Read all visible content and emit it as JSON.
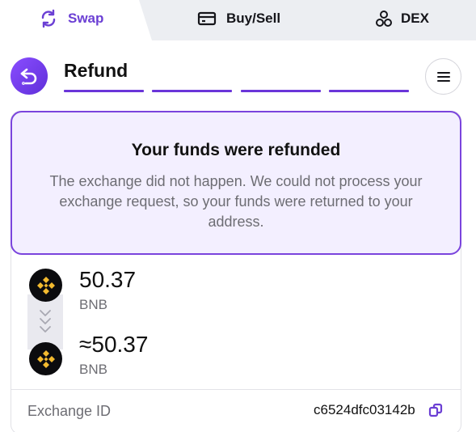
{
  "tabs": [
    {
      "label": "Swap",
      "icon": "swap-icon",
      "active": true
    },
    {
      "label": "Buy/Sell",
      "icon": "card-icon",
      "active": false
    },
    {
      "label": "DEX",
      "icon": "dex-icon",
      "active": false
    }
  ],
  "header": {
    "title": "Refund",
    "steps_total": 4,
    "back_icon": "back-arrow-icon",
    "menu_icon": "hamburger-icon"
  },
  "notice": {
    "title": "Your funds were refunded",
    "text": "The exchange did not happen. We could not process your exchange request, so your funds were returned to your address."
  },
  "exchange": {
    "from": {
      "amount": "50.37",
      "ticker": "BNB",
      "icon": "bnb-icon"
    },
    "to": {
      "amount": "≈50.37",
      "ticker": "BNB",
      "icon": "bnb-icon"
    }
  },
  "details": {
    "exchange_id_label": "Exchange ID",
    "exchange_id_value": "c6524dfc03142b",
    "copy_icon": "copy-icon"
  },
  "colors": {
    "accent": "#6b3fd4",
    "notice_bg": "#f3efff",
    "bnb_yellow": "#f3ba2f"
  }
}
